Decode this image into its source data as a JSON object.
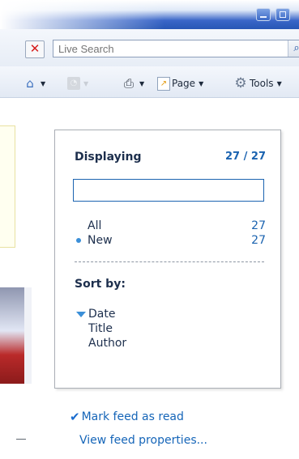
{
  "browser": {
    "search": {
      "placeholder": "Live Search"
    },
    "toolbar": {
      "page_label": "Page",
      "tools_label": "Tools"
    }
  },
  "panel": {
    "heading": "Displaying",
    "count": "27 / 27",
    "filter_value": "",
    "filters": [
      {
        "label": "All",
        "count": "27",
        "selected": false
      },
      {
        "label": "New",
        "count": "27",
        "selected": true
      }
    ],
    "sort_heading": "Sort by:",
    "sort_options": [
      {
        "label": "Date",
        "selected": true
      },
      {
        "label": "Title",
        "selected": false
      },
      {
        "label": "Author",
        "selected": false
      }
    ]
  },
  "links": {
    "mark_read": "Mark feed as read",
    "view_properties": "View feed properties..."
  },
  "colors": {
    "accent": "#1b63b0",
    "bullet": "#3b8fd8",
    "link": "#1565b8"
  },
  "icons": [
    "stop-icon",
    "search-icon",
    "home-icon",
    "feeds-icon",
    "print-icon",
    "page-icon",
    "tools-icon",
    "checkmark-icon"
  ]
}
